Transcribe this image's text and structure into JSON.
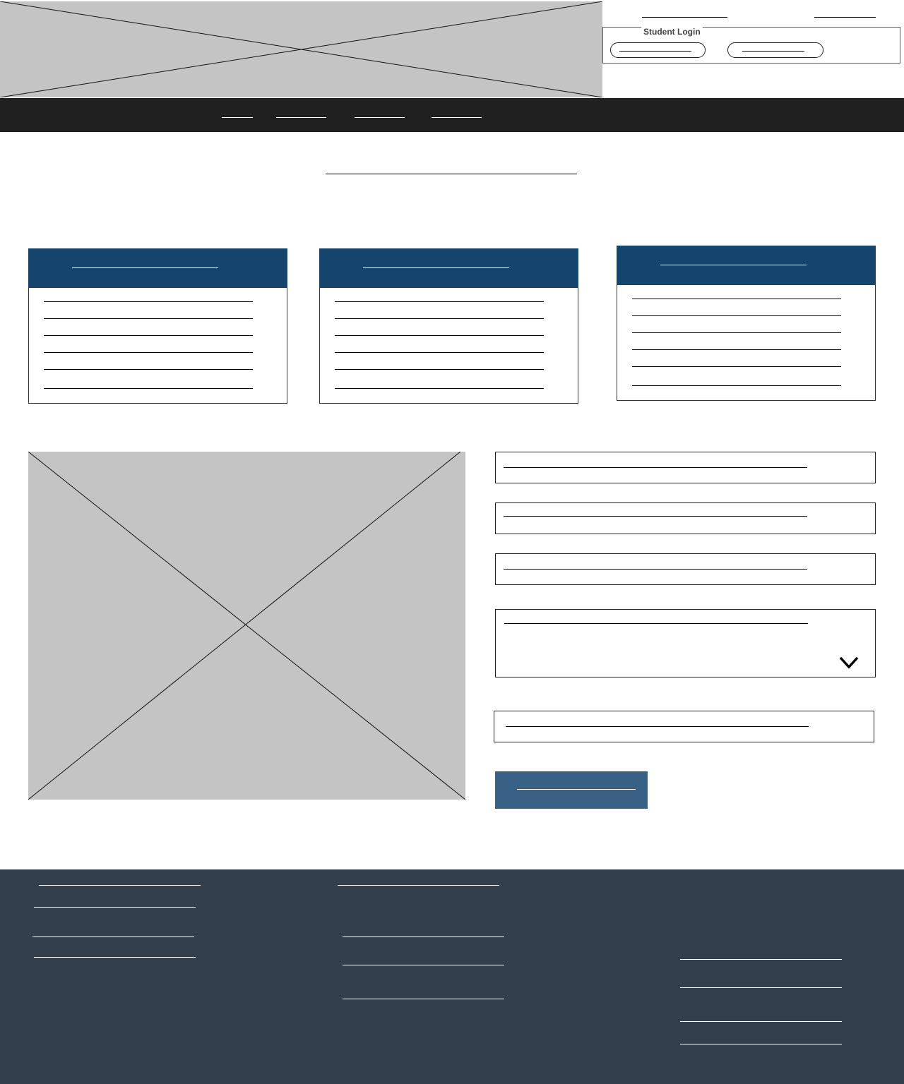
{
  "header": {
    "logo_placeholder": "image-placeholder",
    "login_legend": "Student Login",
    "top_links": [
      "",
      ""
    ],
    "login_buttons": [
      "",
      ""
    ]
  },
  "nav": {
    "items": [
      "",
      "",
      "",
      ""
    ]
  },
  "main": {
    "title": "",
    "cards": [
      {
        "title": "",
        "lines": [
          "",
          "",
          "",
          "",
          "",
          ""
        ]
      },
      {
        "title": "",
        "lines": [
          "",
          "",
          "",
          "",
          "",
          ""
        ]
      },
      {
        "title": "",
        "lines": [
          "",
          "",
          "",
          "",
          "",
          ""
        ]
      }
    ]
  },
  "form": {
    "fields": [
      "",
      "",
      ""
    ],
    "select": {
      "value": "",
      "icon": "chevron-down-icon"
    },
    "extra_field": "",
    "submit_label": ""
  },
  "footer": {
    "col1": [
      "",
      "",
      "",
      ""
    ],
    "col2": [
      "",
      "",
      "",
      ""
    ],
    "col3": [
      "",
      "",
      "",
      ""
    ]
  },
  "colors": {
    "nav_bg": "#202020",
    "card_header": "#15456c",
    "submit_bg": "#396185",
    "footer_bg": "#333f4d",
    "placeholder": "#c4c4c4"
  }
}
